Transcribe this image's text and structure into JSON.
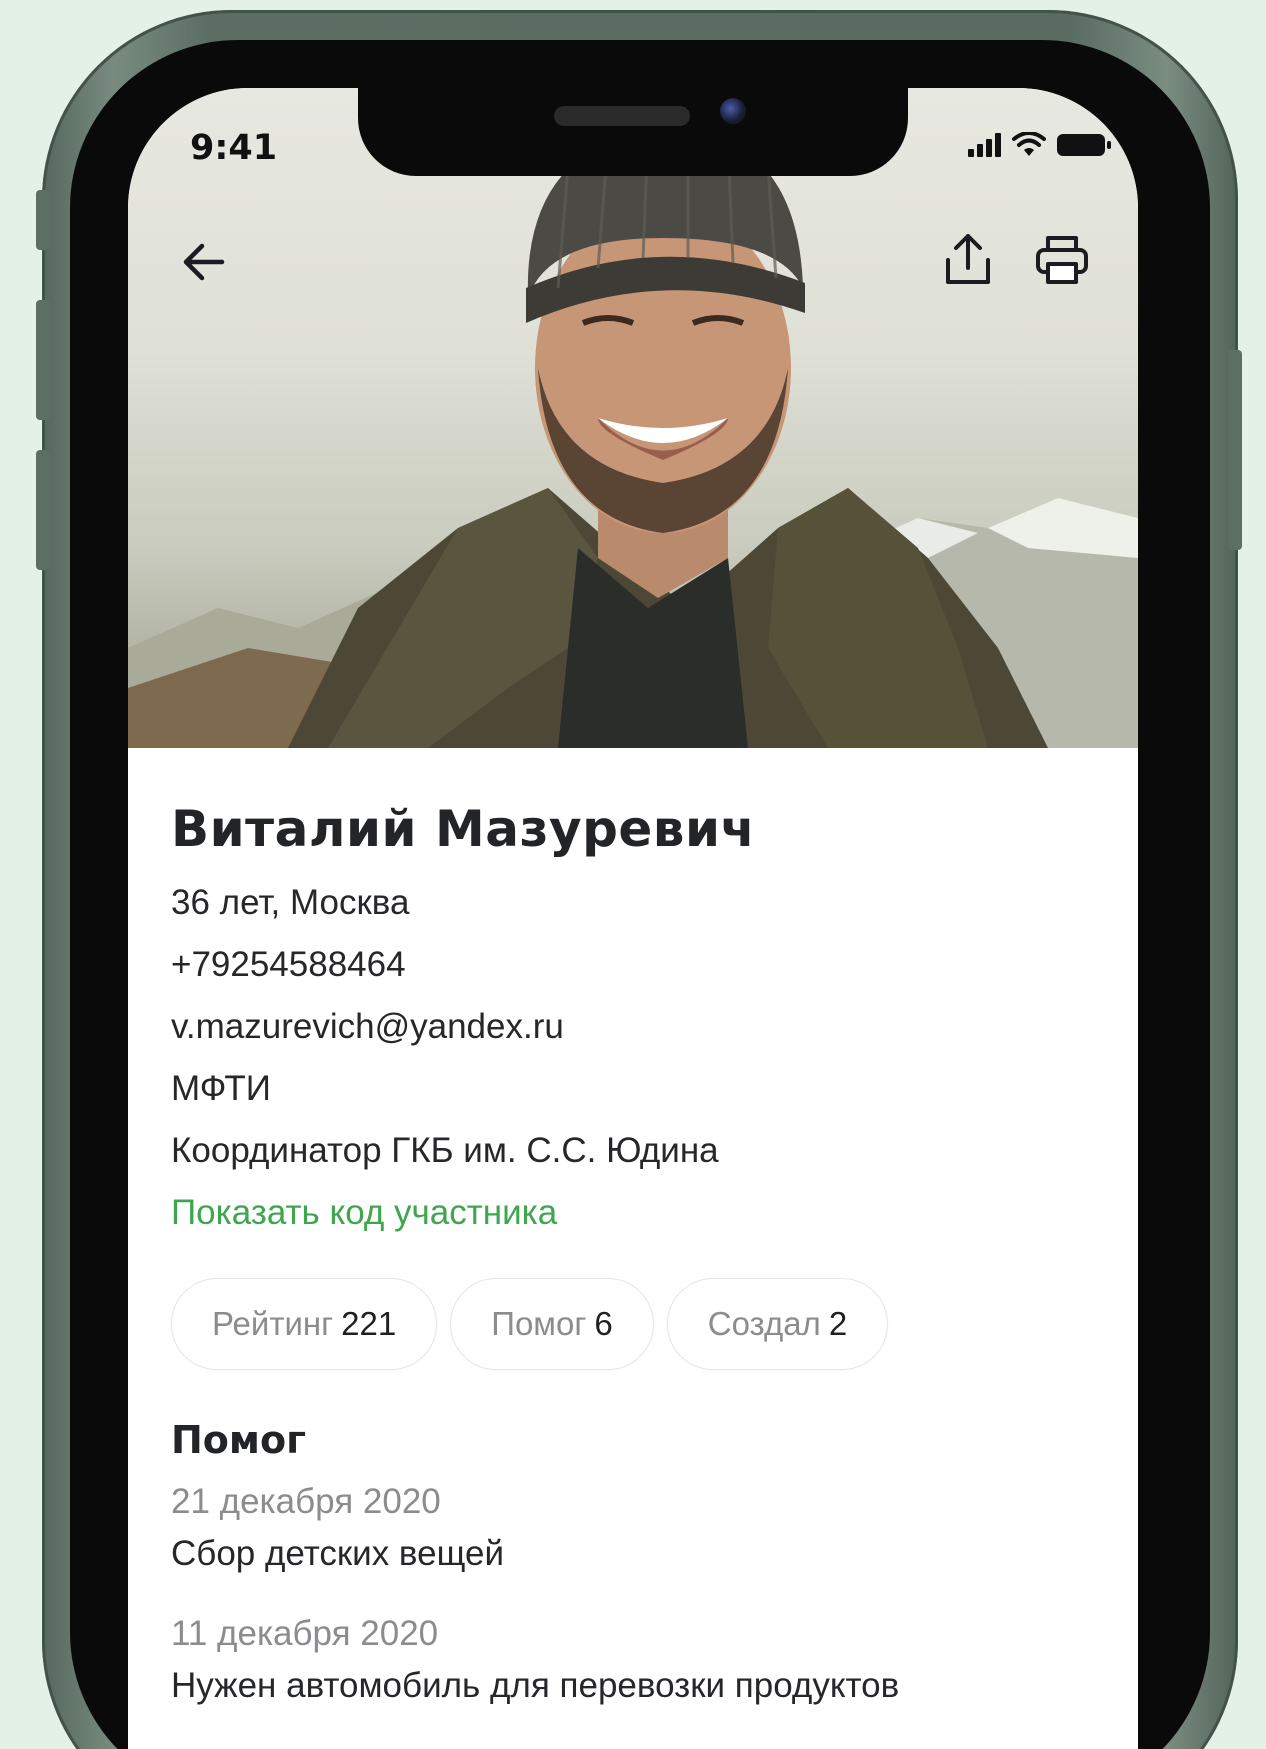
{
  "status_bar": {
    "time": "9:41",
    "icons": [
      "signal-icon",
      "wifi-icon",
      "battery-icon"
    ]
  },
  "header": {
    "back_icon": "arrow-left-icon",
    "share_icon": "share-icon",
    "print_icon": "printer-icon"
  },
  "profile": {
    "name": "Виталий Мазуревич",
    "age_city": "36 лет, Москва",
    "phone": "+79254588464",
    "email": "v.mazurevich@yandex.ru",
    "university": "МФТИ",
    "role": "Координатор ГКБ им. С.С. Юдина",
    "show_code_link": "Показать код участника"
  },
  "stats": [
    {
      "label": "Рейтинг",
      "value": "221"
    },
    {
      "label": "Помог",
      "value": "6"
    },
    {
      "label": "Создал",
      "value": "2"
    }
  ],
  "helped_section": {
    "title": "Помог",
    "items": [
      {
        "date": "21 декабря 2020",
        "title": "Сбор детских вещей"
      },
      {
        "date": "11 декабря 2020",
        "title": "Нужен автомобиль для перевозки продуктов"
      }
    ]
  },
  "colors": {
    "accent_green": "#3fa64f",
    "background": "#e4f1e7",
    "phone_frame": "#5c6e63"
  }
}
